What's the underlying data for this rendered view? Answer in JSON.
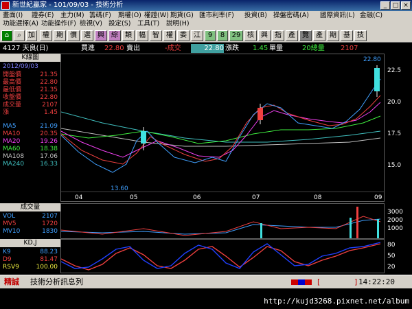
{
  "window": {
    "title": "新世紀贏家 - 101/09/03 - 技術分析"
  },
  "menu": [
    "畫面(I)",
    "證券(E)",
    "主力(M)",
    "籌碼(F)",
    "期權(O)",
    "權證(W)",
    "期貨(G)",
    "匯市利率(F)",
    "投資(B)",
    "操盤密碼(A)",
    "國際資訊(L)",
    "金融(C)",
    "功能選擇(A)",
    "功能操作(F)",
    "檢視(V)",
    "設定(S)",
    "工具(T)",
    "說明(H)"
  ],
  "toolbar": {
    "buttons": [
      "加",
      "權",
      "期",
      "價",
      "選",
      "興",
      "綜",
      "類",
      "幅",
      "智",
      "權",
      "委",
      "江",
      "9",
      "8",
      "29",
      "核",
      "興",
      "指",
      "產",
      "覽",
      "產",
      "期",
      "基",
      "技"
    ]
  },
  "info": {
    "symbol": "4127 天良(日)",
    "buy_label": "買進",
    "buy": "22.80",
    "sell_label": "賣出",
    "change_label": "-成交",
    "last": "22.80",
    "chg_label": "漲跌",
    "chg": "1.45",
    "unit_label": "單量",
    "vol_label": "20總量",
    "total": "2107"
  },
  "left": {
    "header": "K線圖",
    "date": "2012/09/03",
    "rows": [
      {
        "k": "開盤價",
        "v": "21.35"
      },
      {
        "k": "最高價",
        "v": "22.80"
      },
      {
        "k": "最低價",
        "v": "21.35"
      },
      {
        "k": "收盤價",
        "v": "22.80"
      },
      {
        "k": "成交量",
        "v": "2107"
      },
      {
        "k": "漲",
        "v": "1.45"
      }
    ],
    "ma": [
      {
        "k": "MA5",
        "v": "21.09"
      },
      {
        "k": "MA10",
        "v": "20.35"
      },
      {
        "k": "MA20",
        "v": "19.26"
      },
      {
        "k": "MA60",
        "v": "18.38"
      },
      {
        "k": "MA108",
        "v": "17.06"
      },
      {
        "k": "MA240",
        "v": "16.33"
      }
    ],
    "vol_header": "成交量",
    "vol": [
      {
        "k": "VOL",
        "v": "2107"
      },
      {
        "k": "MV5",
        "v": "1720"
      },
      {
        "k": "MV10",
        "v": "1830"
      }
    ],
    "kd_header": "KD,J",
    "kd": [
      {
        "k": "K9",
        "v": "88.23"
      },
      {
        "k": "D9",
        "v": "81.47"
      },
      {
        "k": "RSV9",
        "v": "100.00"
      }
    ]
  },
  "chart": {
    "price_axis": [
      "22.5",
      "20.0",
      "17.5",
      "15.0"
    ],
    "high_mark": "22.80",
    "low_mark": "13.60",
    "months": [
      "04",
      "05",
      "06",
      "07",
      "08",
      "09"
    ],
    "vol_axis": [
      "3000",
      "2000",
      "1000"
    ],
    "kd_axis": [
      "80",
      "50",
      "20"
    ]
  },
  "status": {
    "tag": "精誠",
    "msg": "技術分析訊息列",
    "bracket_l": "[",
    "bracket_r": "]",
    "time": "14:22:20"
  },
  "footer": {
    "url": "http://kujd3268.pixnet.net/album"
  }
}
